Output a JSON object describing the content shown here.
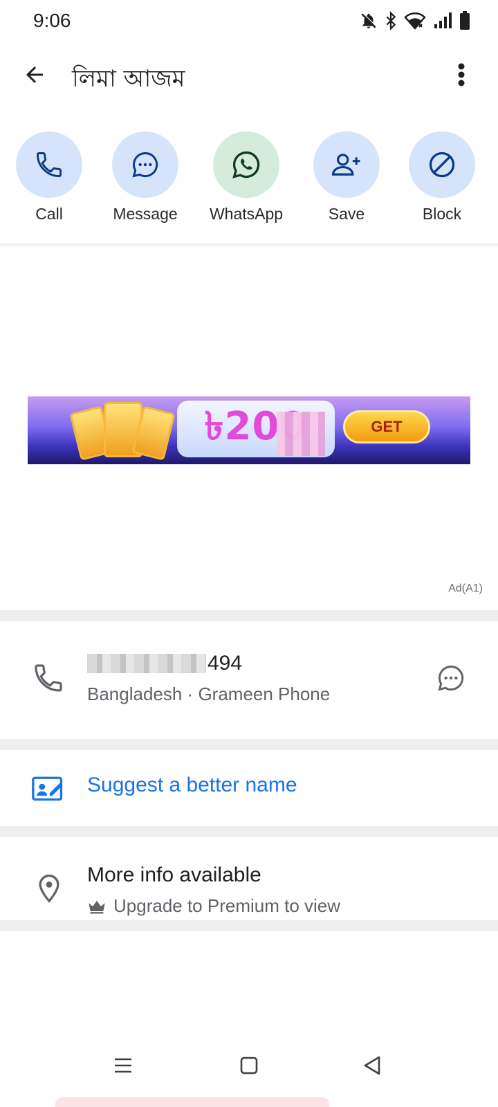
{
  "status_bar": {
    "time": "9:06",
    "icons": [
      "bell-off-icon",
      "bluetooth-icon",
      "wifi-icon",
      "signal-icon",
      "battery-icon"
    ]
  },
  "app_bar": {
    "title": "লিমা আজম",
    "back_icon": "arrow-back-icon",
    "overflow_icon": "more-vert-icon"
  },
  "actions": [
    {
      "label": "Call",
      "icon": "phone-icon",
      "color": "#d6e4fb"
    },
    {
      "label": "Message",
      "icon": "chat-bubble-icon",
      "color": "#d6e4fb"
    },
    {
      "label": "WhatsApp",
      "icon": "whatsapp-icon",
      "color": "#d5ecdc"
    },
    {
      "label": "Save",
      "icon": "person-add-icon",
      "color": "#d6e4fb"
    },
    {
      "label": "Block",
      "icon": "block-icon",
      "color": "#d6e4fb"
    }
  ],
  "ad": {
    "banner_text": "৳200",
    "cta": "GET",
    "tag": "Ad(A1)"
  },
  "phone": {
    "number_suffix": "494",
    "details": "Bangladesh · Grameen Phone"
  },
  "suggest": {
    "label": "Suggest a better name"
  },
  "more_info": {
    "title": "More info available",
    "subtitle": "Upgrade to Premium to view"
  },
  "colors": {
    "accent": "#1a73e8",
    "action_bg": "#d6e4fb",
    "whatsapp_bg": "#d5ecdc",
    "icon_dark": "#0b3a8a"
  }
}
